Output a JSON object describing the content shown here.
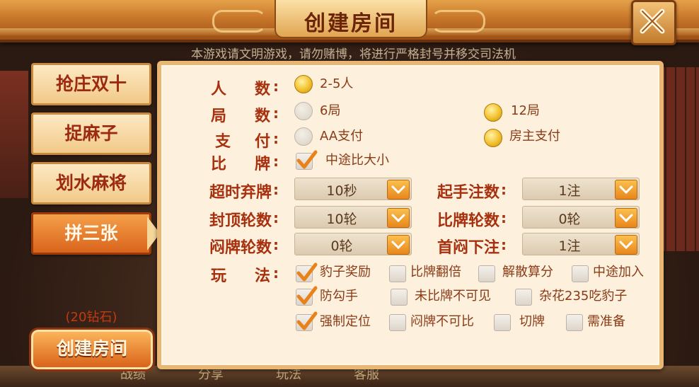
{
  "window": {
    "title": "创建房间"
  },
  "notice": "本游戏请文明游戏，请勿赌博，将进行严格封号并移交司法机",
  "bottom_nav": [
    "战绩",
    "分享",
    "玩法",
    "客服"
  ],
  "tabs": [
    {
      "label": "抢庄双十",
      "active": false
    },
    {
      "label": "捉麻子",
      "active": false
    },
    {
      "label": "划水麻将",
      "active": false
    },
    {
      "label": "拼三张",
      "active": true
    }
  ],
  "cost_label": "(20钻石)",
  "create_button": "创建房间",
  "form": {
    "players": {
      "label_a": "人",
      "label_b": "数",
      "options": [
        {
          "text": "2-5人",
          "selected": true
        }
      ]
    },
    "rounds": {
      "label_a": "局",
      "label_b": "数",
      "options": [
        {
          "text": "6局",
          "selected": false
        },
        {
          "text": "12局",
          "selected": true
        }
      ]
    },
    "payment": {
      "label_a": "支",
      "label_b": "付",
      "options": [
        {
          "text": "AA支付",
          "selected": false
        },
        {
          "text": "房主支付",
          "selected": true
        }
      ]
    },
    "compare": {
      "label_a": "比",
      "label_b": "牌",
      "option": {
        "text": "中途比大小",
        "checked": true
      }
    },
    "selects": [
      {
        "label": "超时弃牌",
        "value": "10秒"
      },
      {
        "label": "起手注数",
        "value": "1注"
      },
      {
        "label": "封顶轮数",
        "value": "10轮"
      },
      {
        "label": "比牌轮数",
        "value": "0轮"
      },
      {
        "label": "闷牌轮数",
        "value": "0轮"
      },
      {
        "label": "首闷下注",
        "value": "1注"
      }
    ],
    "rules": {
      "label_a": "玩",
      "label_b": "法",
      "options": [
        {
          "text": "豹子奖励",
          "checked": true
        },
        {
          "text": "比牌翻倍",
          "checked": false
        },
        {
          "text": "解散算分",
          "checked": false
        },
        {
          "text": "中途加入",
          "checked": false
        },
        {
          "text": "防勾手",
          "checked": true
        },
        {
          "text": "未比牌不可见",
          "checked": false
        },
        {
          "text": "杂花235吃豹子",
          "checked": false
        },
        {
          "text": "强制定位",
          "checked": true
        },
        {
          "text": "闷牌不可比",
          "checked": false
        },
        {
          "text": "切牌",
          "checked": false
        },
        {
          "text": "需准备",
          "checked": false
        }
      ]
    },
    "colon": ":"
  },
  "colors": {
    "accent": "#d9641c",
    "label": "#a7300e",
    "panel": "#fdf1dd"
  }
}
